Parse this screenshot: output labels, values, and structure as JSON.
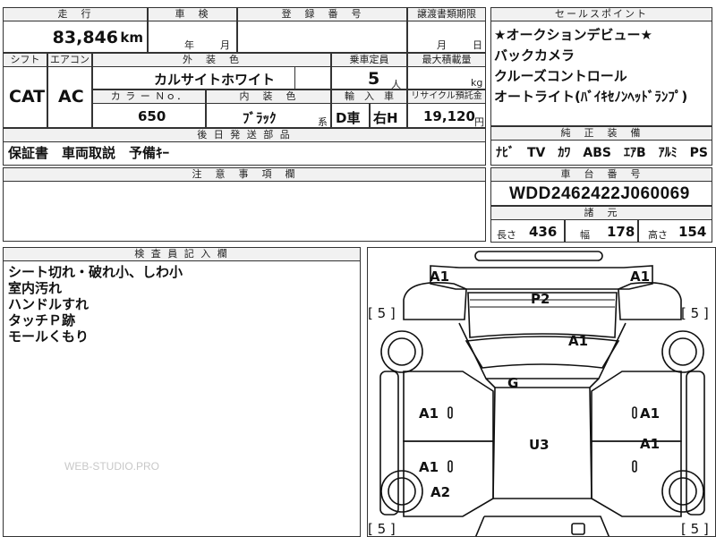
{
  "headers": {
    "mileage": "走　行",
    "inspection": "車　検",
    "registration": "登　録　番　号",
    "transfer_deadline": "譲渡書類期限",
    "sales_points": "セールスポイント",
    "shift": "シフト",
    "aircon": "エアコン",
    "exterior_color": "外　装　色",
    "capacity": "乗車定員",
    "max_load": "最大積載量",
    "color_no": "カ ラ ー Ｎｏ．",
    "interior_color": "内　装　色",
    "import": "輸　入　車",
    "recycle": "リサイクル預託金",
    "accessories": "後 日 発 送 部 品",
    "equipment": "純　正　装　備",
    "notes": "注　意　事　項　欄",
    "chassis": "車　台　番　号",
    "dimensions": "諸　元",
    "inspector": "検 査 員 記 入 欄"
  },
  "vehicle": {
    "mileage_value": "83,846",
    "mileage_unit": "km",
    "year_label": "年",
    "month_label": "月",
    "deadline_month": "月",
    "deadline_day": "日",
    "shift_value": "CAT",
    "aircon_value": "AC",
    "exterior_color_value": "カルサイトホワイト",
    "capacity_value": "5",
    "capacity_unit": "人",
    "load_unit": "kg",
    "color_no_value": "650",
    "interior_color_value": "ﾌﾞﾗｯｸ",
    "interior_suffix": "系",
    "drive_side": "D車",
    "steering": "右H",
    "recycle_value": "19,120",
    "recycle_unit": "円",
    "chassis_number": "WDD2462422J060069"
  },
  "sales_points": [
    "★オークションデビュー★",
    "バックカメラ",
    "クルーズコントロール",
    "オートライト(ﾊﾞｲｷｾﾉﾝﾍｯﾄﾞﾗﾝﾌﾟ)"
  ],
  "accessories_text": "保証書　車両取説　予備ｷｰ",
  "equipment_text": "ﾅﾋﾞ　TV　ｶﾜ　ABS　ｴｱB　ｱﾙﾐ　PS　PW",
  "dimensions": {
    "length_label": "長さ",
    "length_value": "436",
    "width_label": "幅",
    "width_value": "178",
    "height_label": "高さ",
    "height_value": "154"
  },
  "inspector_notes": [
    "シート切れ・破れ小、しわ小",
    "室内汚れ",
    "ハンドルすれ",
    "タッチＰ跡",
    "モールくもり"
  ],
  "diagram_marks": {
    "front_left": "A1",
    "front_right": "A1",
    "windshield": "P2",
    "hood": "A1",
    "glass": "G",
    "roof": "U3",
    "left_front_door": "A1",
    "right_front_door": "A1",
    "left_rear_door": "A1",
    "right_rear_door": "A1",
    "left_rear_quarter": "A2",
    "tire_front_left": "[ 5 ]",
    "tire_front_right": "[ 5 ]",
    "tire_rear_left": "[ 5 ]",
    "tire_rear_right": "[ 5 ]"
  },
  "watermark": "WEB-STUDIO.PRO"
}
